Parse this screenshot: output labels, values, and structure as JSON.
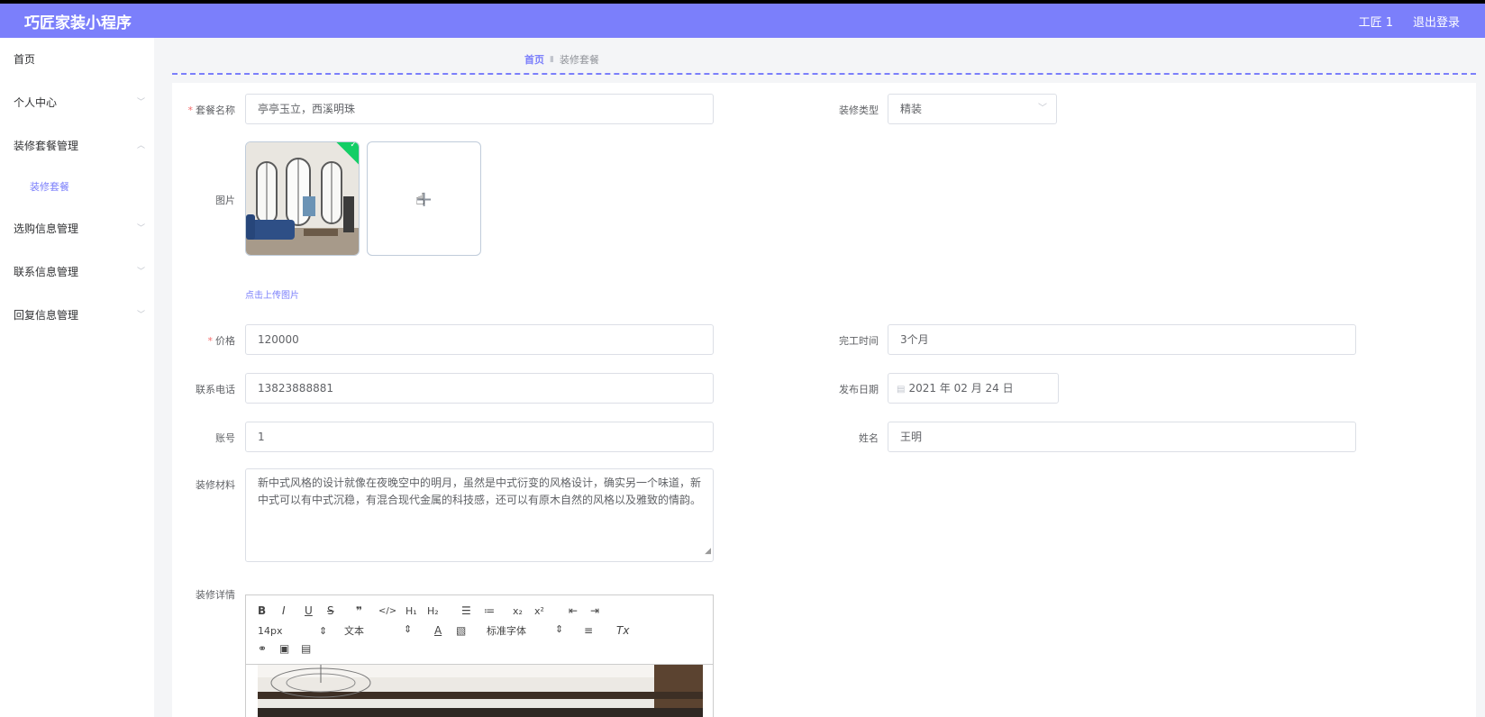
{
  "header": {
    "title": "巧匠家装小程序",
    "user": "工匠 1",
    "logout": "退出登录"
  },
  "sidebar": {
    "items": [
      {
        "label": "首页"
      },
      {
        "label": "个人中心"
      },
      {
        "label": "装修套餐管理"
      },
      {
        "label": "装修套餐"
      },
      {
        "label": "选购信息管理"
      },
      {
        "label": "联系信息管理"
      },
      {
        "label": "回复信息管理"
      }
    ]
  },
  "breadcrumb": {
    "home": "首页",
    "current": "装修套餐"
  },
  "form": {
    "name_label": "套餐名称",
    "name_value": "亭亭玉立，西溪明珠",
    "type_label": "装修类型",
    "type_value": "精装",
    "image_label": "图片",
    "upload_tip": "点击上传图片",
    "price_label": "价格",
    "price_value": "120000",
    "duration_label": "完工时间",
    "duration_value": "3个月",
    "phone_label": "联系电话",
    "phone_value": "13823888881",
    "date_label": "发布日期",
    "date_value": "2021 年 02 月 24 日",
    "account_label": "账号",
    "account_value": "1",
    "person_label": "姓名",
    "person_value": "王明",
    "material_label": "装修材料",
    "material_value": "新中式风格的设计就像在夜晚空中的明月，虽然是中式衍变的风格设计，确实另一个味道，新中式可以有中式沉稳，有混合现代金属的科技感，还可以有原木自然的风格以及雅致的情韵。",
    "detail_label": "装修详情"
  },
  "editor": {
    "font_size": "14px",
    "format": "文本",
    "font_family": "标准字体"
  },
  "colors": {
    "accent": "#7b7ffb",
    "success": "#13ce66",
    "required": "#f56c6c"
  }
}
